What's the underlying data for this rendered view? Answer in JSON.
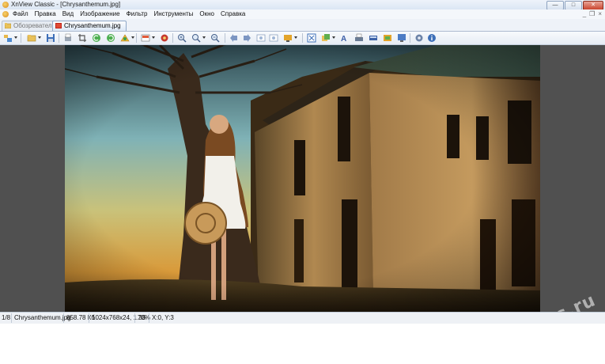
{
  "window": {
    "title": "XnView Classic - [Chrysanthemum.jpg]",
    "minimize_label": "—",
    "maximize_label": "□",
    "close_label": "✕"
  },
  "menu": {
    "items": [
      "Файл",
      "Правка",
      "Вид",
      "Изображение",
      "Фильтр",
      "Инструменты",
      "Окно",
      "Справка"
    ],
    "mdi_minimize": "_",
    "mdi_restore": "❐",
    "mdi_close": "×"
  },
  "tabs": [
    {
      "label": "Обозреватель",
      "active": false
    },
    {
      "label": "Chrysanthemum.jpg",
      "active": true
    }
  ],
  "toolbar": {
    "icons": [
      "browser-icon",
      "open-folder-icon",
      "save-icon",
      "print-preview-icon",
      "crop-icon",
      "rotate-left-icon",
      "rotate-right-icon",
      "adjust-icon",
      "slideshow-icon",
      "settings-icon",
      "zoom-in-icon",
      "zoom-icon",
      "zoom-out-icon",
      "previous-icon",
      "next-icon",
      "first-icon",
      "last-icon",
      "fullscreen-icon",
      "fit-icon",
      "copy-icon",
      "font-icon",
      "print-icon",
      "scan-icon",
      "capture-icon",
      "wallpaper-icon",
      "options-icon",
      "info-icon"
    ]
  },
  "status": {
    "index": "1/8",
    "filename": "Chrysanthemum.jpg",
    "filesize": "858.78 Кб",
    "dimensions": "1024x768x24, 1.33",
    "zoom": "78%",
    "coords": "X:0, Y:3"
  },
  "watermark": "tips-blogs.ru",
  "colors": {
    "viewer_background": "#505050",
    "accent": "#3b6db3"
  }
}
